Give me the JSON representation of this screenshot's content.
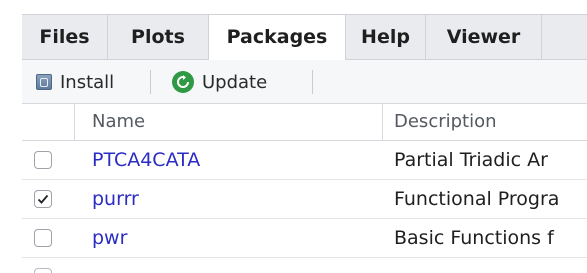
{
  "tabs": [
    {
      "label": "Files"
    },
    {
      "label": "Plots"
    },
    {
      "label": "Packages"
    },
    {
      "label": "Help"
    },
    {
      "label": "Viewer"
    }
  ],
  "toolbar": {
    "install_label": "Install",
    "update_label": "Update"
  },
  "table": {
    "headers": {
      "name": "Name",
      "description": "Description"
    },
    "rows": [
      {
        "name": "PTCA4CATA",
        "description": "Partial Triadic Ar",
        "checked": false
      },
      {
        "name": "purrr",
        "description": "Functional Progra",
        "checked": true
      },
      {
        "name": "pwr",
        "description": "Basic Functions f",
        "checked": false
      }
    ]
  },
  "colors": {
    "package_link": "#2a2cc4",
    "update_icon": "#2f9a43",
    "tab_bg": "#e9ebee"
  }
}
